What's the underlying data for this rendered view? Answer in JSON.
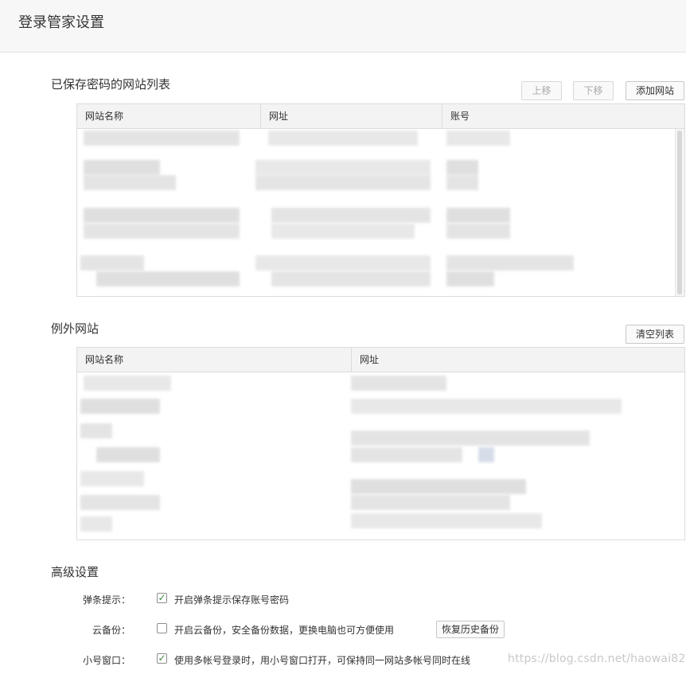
{
  "header": {
    "title": "登录管家设置"
  },
  "saved_sites": {
    "title": "已保存密码的网站列表",
    "buttons": {
      "move_up": "上移",
      "move_down": "下移",
      "add_site": "添加网站"
    },
    "columns": [
      "网站名称",
      "网址",
      "账号"
    ]
  },
  "exception_sites": {
    "title": "例外网站",
    "buttons": {
      "clear_list": "清空列表"
    },
    "columns": [
      "网站名称",
      "网址"
    ]
  },
  "advanced": {
    "title": "高级设置",
    "popup_hint": {
      "label": "弹条提示：",
      "checked": true,
      "text": "开启弹条提示保存账号密码"
    },
    "cloud_backup": {
      "label": "云备份：",
      "checked": false,
      "text": "开启云备份，安全备份数据，更换电脑也可方便使用",
      "restore_button": "恢复历史备份"
    },
    "small_window": {
      "label": "小号窗口：",
      "checked": true,
      "text": "使用多帐号登录时，用小号窗口打开，可保持同一网站多帐号同时在线"
    }
  },
  "watermark": "https://blog.csdn.net/haowai82",
  "colors": {
    "check": "#3c8c3c",
    "header_bg": "#f7f7f7",
    "table_header_bg": "#f3f3f3"
  }
}
